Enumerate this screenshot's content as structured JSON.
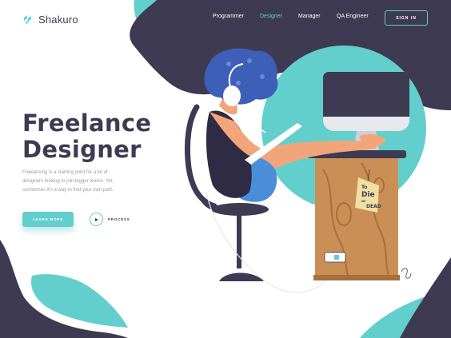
{
  "brand": {
    "name": "Shakuro",
    "icon": "shakuro-logo-icon"
  },
  "nav": {
    "items": [
      "Programmer",
      "Designer",
      "Manager",
      "QA Engineer"
    ],
    "active": "Designer"
  },
  "signin_label": "SIGN IN",
  "hero": {
    "title_line1": "Freelance",
    "title_line2": "Designer",
    "description": "Freelancing is a starting point for a lot of designers looking to join bigger teams. Yet, sometimes it's a way to find your own path.",
    "learn_more_label": "LEARN MORE",
    "process_label": "PROCESS"
  },
  "illustration": {
    "desk_note": {
      "line1": "To",
      "line2": "Die",
      "line3": "or",
      "line4": "DEAD"
    }
  },
  "colors": {
    "dark": "#3e3a52",
    "teal": "#63cfcc",
    "text_muted": "#9a9aaa",
    "white": "#ffffff"
  }
}
